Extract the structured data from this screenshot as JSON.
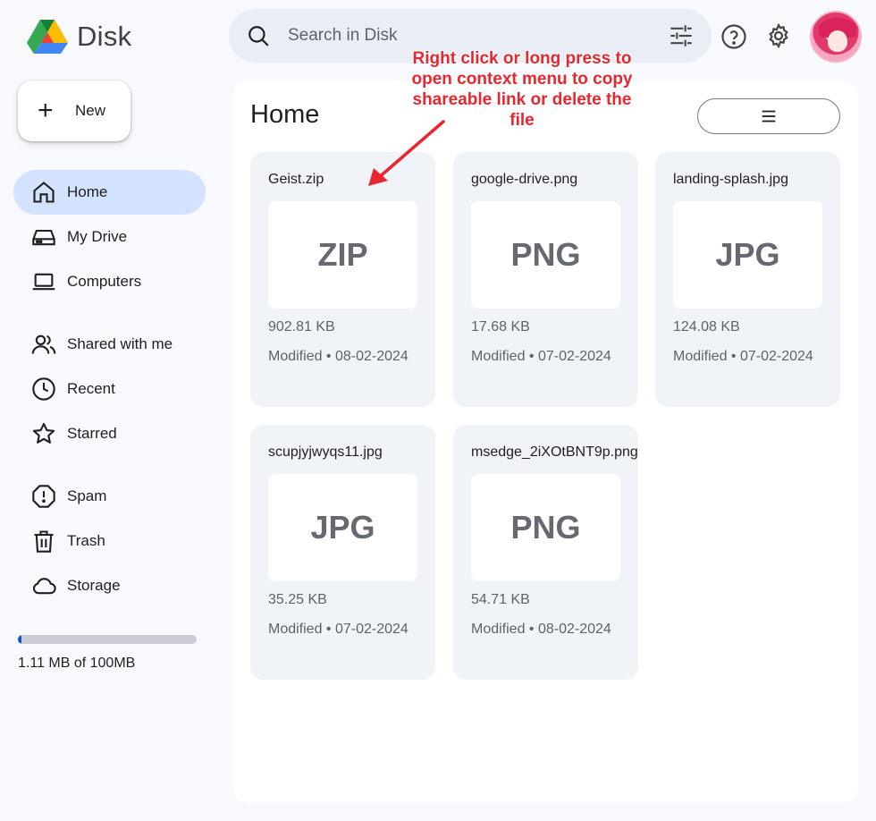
{
  "app": {
    "name": "Disk"
  },
  "search": {
    "placeholder": "Search in Disk"
  },
  "sidebar": {
    "new_label": "New",
    "items": [
      {
        "label": "Home",
        "icon": "home-icon",
        "active": true
      },
      {
        "label": "My Drive",
        "icon": "drive-icon"
      },
      {
        "label": "Computers",
        "icon": "laptop-icon"
      },
      {
        "label": "Shared with me",
        "icon": "people-icon"
      },
      {
        "label": "Recent",
        "icon": "clock-icon"
      },
      {
        "label": "Starred",
        "icon": "star-icon"
      },
      {
        "label": "Spam",
        "icon": "spam-icon"
      },
      {
        "label": "Trash",
        "icon": "trash-icon"
      },
      {
        "label": "Storage",
        "icon": "cloud-icon"
      }
    ],
    "storage": {
      "text": "1.11 MB of 100MB",
      "used_fraction": 0.011
    }
  },
  "main": {
    "title": "Home",
    "view": "grid",
    "files": [
      {
        "name": "Geist.zip",
        "type": "ZIP",
        "size": "902.81 KB",
        "modified": "Modified • 08-02-2024"
      },
      {
        "name": "google-drive.png",
        "type": "PNG",
        "size": "17.68 KB",
        "modified": "Modified • 07-02-2024"
      },
      {
        "name": "landing-splash.jpg",
        "type": "JPG",
        "size": "124.08 KB",
        "modified": "Modified • 07-02-2024"
      },
      {
        "name": "scupjyjwyqs11.jpg",
        "type": "JPG",
        "size": "35.25 KB",
        "modified": "Modified • 07-02-2024"
      },
      {
        "name": "msedge_2iXOtBNT9p.png",
        "type": "PNG",
        "size": "54.71 KB",
        "modified": "Modified • 08-02-2024"
      }
    ]
  },
  "annotation": {
    "text": "Right click or long press to open context menu to copy shareable link or delete the file",
    "color": "#e7272f"
  },
  "colors": {
    "active_nav": "#d3e3fd",
    "accent": "#0b57d0"
  }
}
